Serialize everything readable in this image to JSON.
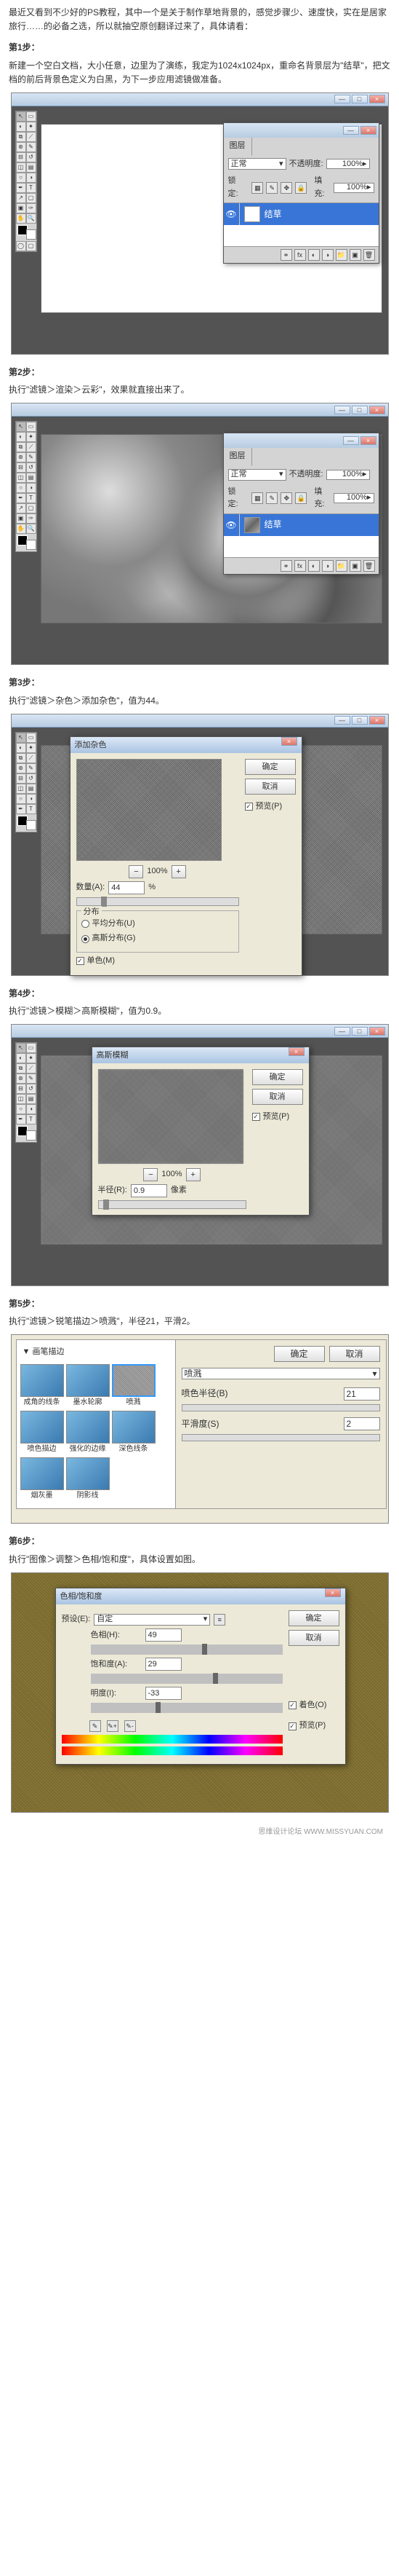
{
  "intro": "最近又看到不少好的PS教程，其中一个是关于制作草地背景的，感觉步骤少、速度快，实在是居家旅行……的必备之选，所以就抽空原创翻译过来了，具体请看：",
  "steps": {
    "s1": {
      "title": "第1步：",
      "text": "新建一个空白文档，大小任意，边里为了演练，我定为1024x1024px，重命名背景层为\"结草\"，把文档的前后背景色定义为白黑，为下一步应用滤镜做准备。"
    },
    "s2": {
      "title": "第2步：",
      "text": "执行\"滤镜＞渲染＞云彩\"，效果就直接出来了。"
    },
    "s3": {
      "title": "第3步：",
      "text": "执行\"滤镜＞杂色＞添加杂色\"，值为44。"
    },
    "s4": {
      "title": "第4步：",
      "text": "执行\"滤镜＞模糊＞高斯模糊\"，值为0.9。"
    },
    "s5": {
      "title": "第5步：",
      "text": "执行\"滤镜＞锐笔描边＞喷溅\"，半径21，平滑2。"
    },
    "s6": {
      "title": "第6步：",
      "text": "执行\"图像＞调整＞色相/饱和度\"，具体设置如图。"
    }
  },
  "layers_panel": {
    "tab": "图层",
    "mode_lbl": "正常",
    "opacity_lbl": "不透明度:",
    "opacity_val": "100%",
    "lock_lbl": "锁定:",
    "fill_lbl": "填充:",
    "fill_val": "100%",
    "layer_name": "结草"
  },
  "noise_dialog": {
    "title": "添加杂色",
    "ok": "确定",
    "cancel": "取消",
    "preview": "预览(P)",
    "zoom": "100%",
    "amount_lbl": "数量(A):",
    "amount_val": "44",
    "amount_unit": "%",
    "dist_lbl": "分布",
    "uniform": "平均分布(U)",
    "gaussian": "高斯分布(G)",
    "mono": "单色(M)"
  },
  "blur_dialog": {
    "title": "高斯模糊",
    "ok": "确定",
    "cancel": "取消",
    "preview": "预览(P)",
    "zoom": "100%",
    "radius_lbl": "半径(R):",
    "radius_val": "0.9",
    "radius_unit": "像素"
  },
  "filter_gallery": {
    "group": "▼ 画笔描边",
    "thumbs": [
      "成角的线条",
      "墨水轮廓",
      "喷溅",
      "喷色描边",
      "强化的边缘",
      "深色线条",
      "烟灰墨",
      "阴影线"
    ],
    "sel_idx": 2,
    "ok": "确定",
    "cancel": "取消",
    "filter_name": "喷溅",
    "radius_lbl": "喷色半径(B)",
    "radius_val": "21",
    "smooth_lbl": "平滑度(S)",
    "smooth_val": "2"
  },
  "hsl_dialog": {
    "title": "色相/饱和度",
    "preset_lbl": "预设(E):",
    "preset_val": "自定",
    "ok": "确定",
    "cancel": "取消",
    "hue_lbl": "色相(H):",
    "hue_val": "49",
    "sat_lbl": "饱和度(A):",
    "sat_val": "29",
    "light_lbl": "明度(I):",
    "light_val": "-33",
    "colorize": "着色(O)",
    "preview": "预览(P)"
  },
  "watermark": "思维设计论坛  WWW.MISSYUAN.COM"
}
